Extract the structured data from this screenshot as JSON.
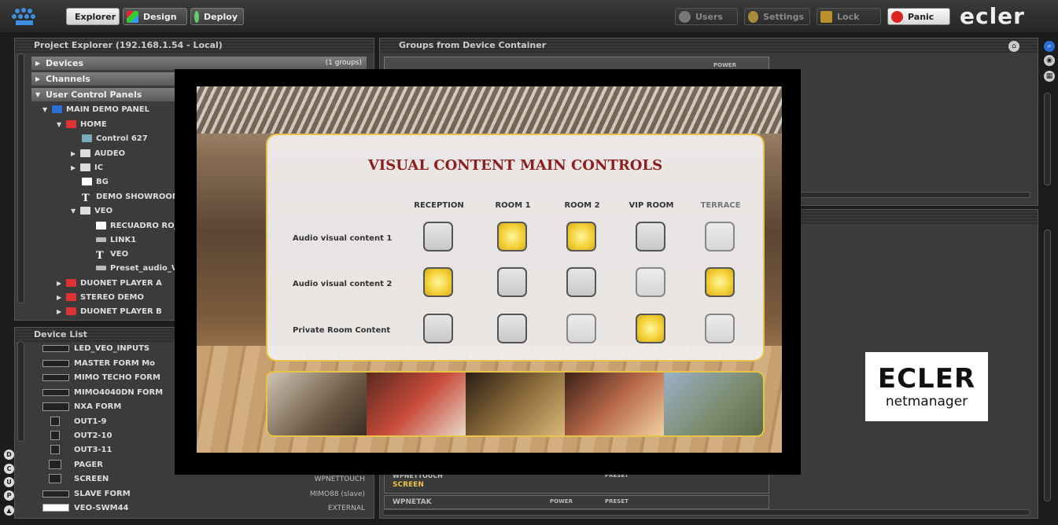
{
  "toolbar": {
    "explorer": "Explorer",
    "design": "Design",
    "deploy": "Deploy",
    "users": "Users",
    "settings": "Settings",
    "lock": "Lock",
    "panic": "Panic",
    "brand": "ecler"
  },
  "project_explorer": {
    "title": "Project Explorer (192.168.1.54 - Local)",
    "sections": {
      "devices": "Devices",
      "devices_count": "(1 groups)",
      "channels": "Channels",
      "ucp": "User Control Panels"
    },
    "tree": [
      "MAIN DEMO PANEL",
      "HOME",
      "Control 627",
      "AUDEO",
      "IC",
      "BG",
      "DEMO SHOWROOM I",
      "VEO",
      "RECUADRO ROJO",
      "LINK1",
      "VEO",
      "Preset_audio_VE",
      "DUONET PLAYER A",
      "STEREO DEMO",
      "DUONET PLAYER B"
    ]
  },
  "groups": {
    "title": "Groups from Device Container",
    "power": "POWER",
    "wpnettouch_tag": "WPNETTOUCH",
    "screen": "SCREEN",
    "wpnetak": "WPNETAK",
    "power2": "POWER",
    "preset": "PRESET",
    "preset_top": "PRESET"
  },
  "device_list": {
    "title": "Device List",
    "items": [
      {
        "name": "LED_VEO_INPUTS",
        "type": ""
      },
      {
        "name": "MASTER FORM Mo",
        "type": ""
      },
      {
        "name": "MIMO TECHO FORM",
        "type": ""
      },
      {
        "name": "MIMO4040DN FORM",
        "type": ""
      },
      {
        "name": "NXA FORM",
        "type": ""
      },
      {
        "name": "OUT1-9",
        "type": ""
      },
      {
        "name": "OUT2-10",
        "type": ""
      },
      {
        "name": "OUT3-11",
        "type": ""
      },
      {
        "name": "PAGER",
        "type": ""
      },
      {
        "name": "SCREEN",
        "type": "WPNETTOUCH"
      },
      {
        "name": "SLAVE FORM",
        "type": "MIMO88 (slave)"
      },
      {
        "name": "VEO-SWM44",
        "type": "EXTERNAL"
      }
    ],
    "side_buttons": [
      "D",
      "C",
      "U",
      "P"
    ]
  },
  "panel": {
    "title": "VISUAL CONTENT MAIN CONTROLS",
    "columns": [
      "RECEPTION",
      "ROOM 1",
      "ROOM 2",
      "VIP ROOM",
      "TERRACE"
    ],
    "rows": [
      {
        "label": "Audio visual content 1",
        "states": [
          "off",
          "on",
          "on",
          "off",
          "light"
        ]
      },
      {
        "label": "Audio visual content 2",
        "states": [
          "on",
          "off",
          "off",
          "light",
          "on"
        ]
      },
      {
        "label": "Private Room Content",
        "states": [
          "off",
          "off",
          "light",
          "on",
          "light"
        ]
      }
    ]
  },
  "netmanager_logo": {
    "brand": "ECLER",
    "sub": "netmanager"
  },
  "colors": {
    "gold": "#e8c34a",
    "title_red": "#8b1f1f",
    "panic_red": "#d22"
  }
}
